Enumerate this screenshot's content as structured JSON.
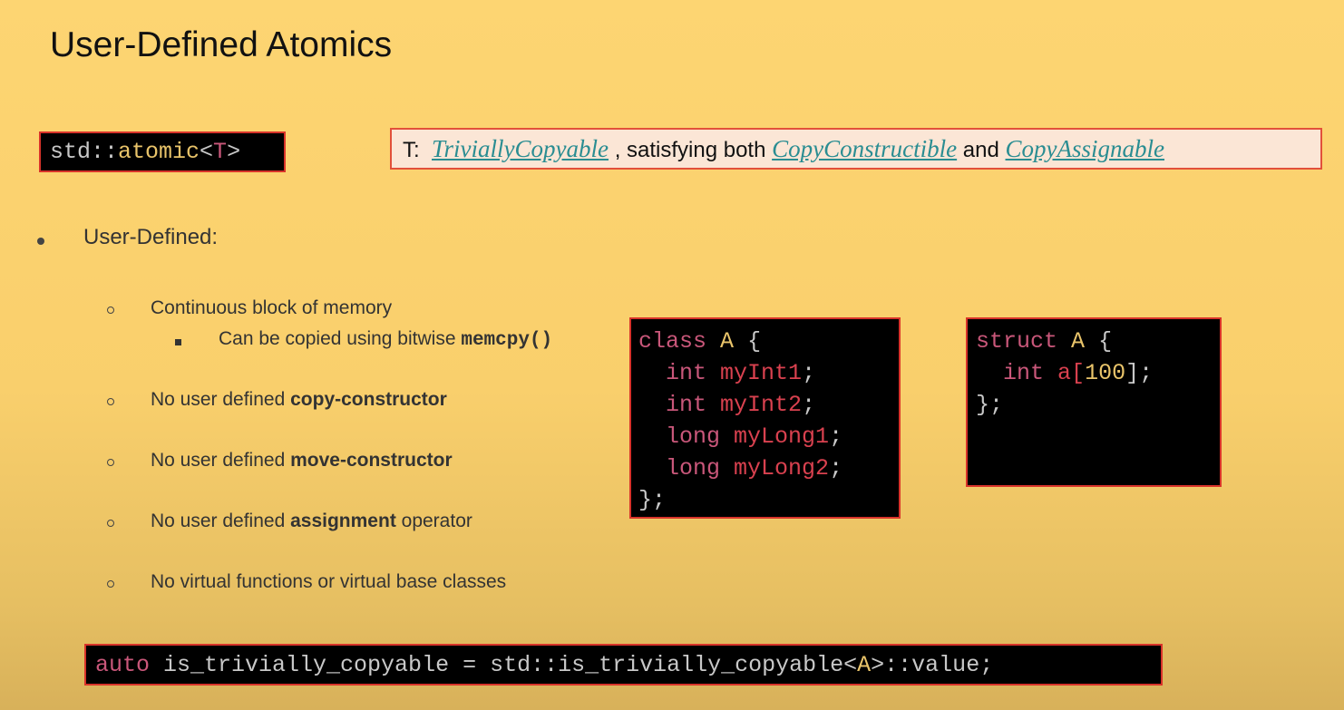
{
  "title": "User-Defined Atomics",
  "atomic": {
    "prefix": "std::",
    "name": "atomic",
    "lt": "<",
    "param": "T",
    "gt": ">"
  },
  "requirement": {
    "label": "T:",
    "link1": "TriviallyCopyable",
    "mid": ", satisfying both",
    "link2": "CopyConstructible",
    "and": "and",
    "link3": "CopyAssignable"
  },
  "bullet": "User-Defined:",
  "items": [
    {
      "pre": "Continuous block of memory",
      "bold": "",
      "post": ""
    },
    {
      "pre": "No user defined ",
      "bold": "copy-constructor",
      "post": ""
    },
    {
      "pre": "No user defined ",
      "bold": "move-constructor",
      "post": ""
    },
    {
      "pre": "No user defined ",
      "bold": "assignment",
      "post": " operator"
    },
    {
      "pre": "No virtual functions or virtual base classes",
      "bold": "",
      "post": ""
    }
  ],
  "subitem": {
    "text": "Can be copied using bitwise ",
    "code": "memcpy()"
  },
  "class_code": {
    "kw": "class",
    "name": "A",
    "open": "{",
    "lines": [
      [
        "int",
        "myInt1"
      ],
      [
        "int",
        "myInt2"
      ],
      [
        "long",
        "myLong1"
      ],
      [
        "long",
        "myLong2"
      ]
    ],
    "close": "};"
  },
  "struct_code": {
    "kw": "struct",
    "name": "A",
    "open": "{",
    "type": "int",
    "member": "a[",
    "size": "100",
    "end": "];",
    "close": "};"
  },
  "bottom_code": {
    "kw": "auto",
    "rest": " is_trivially_copyable = std::is_trivially_copyable<",
    "ty": "A",
    "end": ">::value;"
  }
}
